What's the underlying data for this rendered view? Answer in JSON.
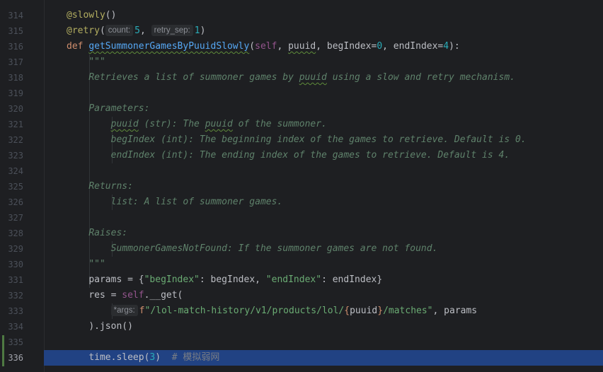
{
  "colors": {
    "background": "#1e1f22",
    "current_line": "#214283",
    "keyword": "#cf8e6d",
    "function": "#56a8f5",
    "string": "#6aab73",
    "number": "#2aacb8",
    "docstring": "#5f826b",
    "comment": "#7a7e85",
    "decorator": "#b3ae60",
    "self": "#94558d"
  },
  "line_numbers": [
    "314",
    "315",
    "316",
    "317",
    "318",
    "319",
    "320",
    "321",
    "322",
    "323",
    "324",
    "325",
    "326",
    "327",
    "328",
    "329",
    "330",
    "331",
    "332",
    "333",
    "334",
    "335",
    "336"
  ],
  "current_line_number": "336",
  "code": {
    "l314_decorator": "@slowly",
    "l314_parens": "()",
    "l315_decorator": "@retry",
    "l315_open": "(",
    "l315_hint_count": "count:",
    "l315_count_value": "5",
    "l315_comma": ", ",
    "l315_hint_retry_sep": "retry_sep:",
    "l315_retry_value": "1",
    "l315_close": ")",
    "l316_def": "def",
    "l316_fn": "getSummonerGamesByPuuidSlowly",
    "l316_open": "(",
    "l316_self": "self",
    "l316_p1": ", ",
    "l316_puuid": "puuid",
    "l316_p2": ", begIndex=",
    "l316_beg_val": "0",
    "l316_p3": ", endIndex=",
    "l316_end_val": "4",
    "l316_close": "):",
    "l317_doc": "\"\"\"",
    "l318_doc_a": "Retrieves a list of summoner games by ",
    "l318_doc_puuid": "puuid",
    "l318_doc_b": " using a slow and retry mechanism.",
    "l320_doc": "Parameters:",
    "l321_doc_puuid": "puuid",
    "l321_doc_a": " (str): The ",
    "l321_doc_puuid2": "puuid",
    "l321_doc_b": " of the summoner.",
    "l322_doc": "begIndex (int): The beginning index of the games to retrieve. Default is 0.",
    "l323_doc": "endIndex (int): The ending index of the games to retrieve. Default is 4.",
    "l325_doc": "Returns:",
    "l326_doc": "list: A list of summoner games.",
    "l328_doc": "Raises:",
    "l329_doc": "SummonerGamesNotFound: If the summoner games are not found.",
    "l330_doc": "\"\"\"",
    "l331_a": "params = {",
    "l331_s1": "\"begIndex\"",
    "l331_b": ": begIndex, ",
    "l331_s2": "\"endIndex\"",
    "l331_c": ": endIndex}",
    "l332_a": "res = ",
    "l332_self": "self",
    "l332_b": ".__get(",
    "l333_hint_args": "*args:",
    "l333_f": "f",
    "l333_s1": "\"/lol-match-history/v1/products/lol/",
    "l333_brace_open": "{",
    "l333_puuid": "puuid",
    "l333_brace_close": "}",
    "l333_s2": "/matches\"",
    "l333_tail": ", params",
    "l334": ").json()",
    "l336_a": "time.sleep(",
    "l336_num": "3",
    "l336_b": ")",
    "l336_comment": "# 模拟弱网"
  }
}
